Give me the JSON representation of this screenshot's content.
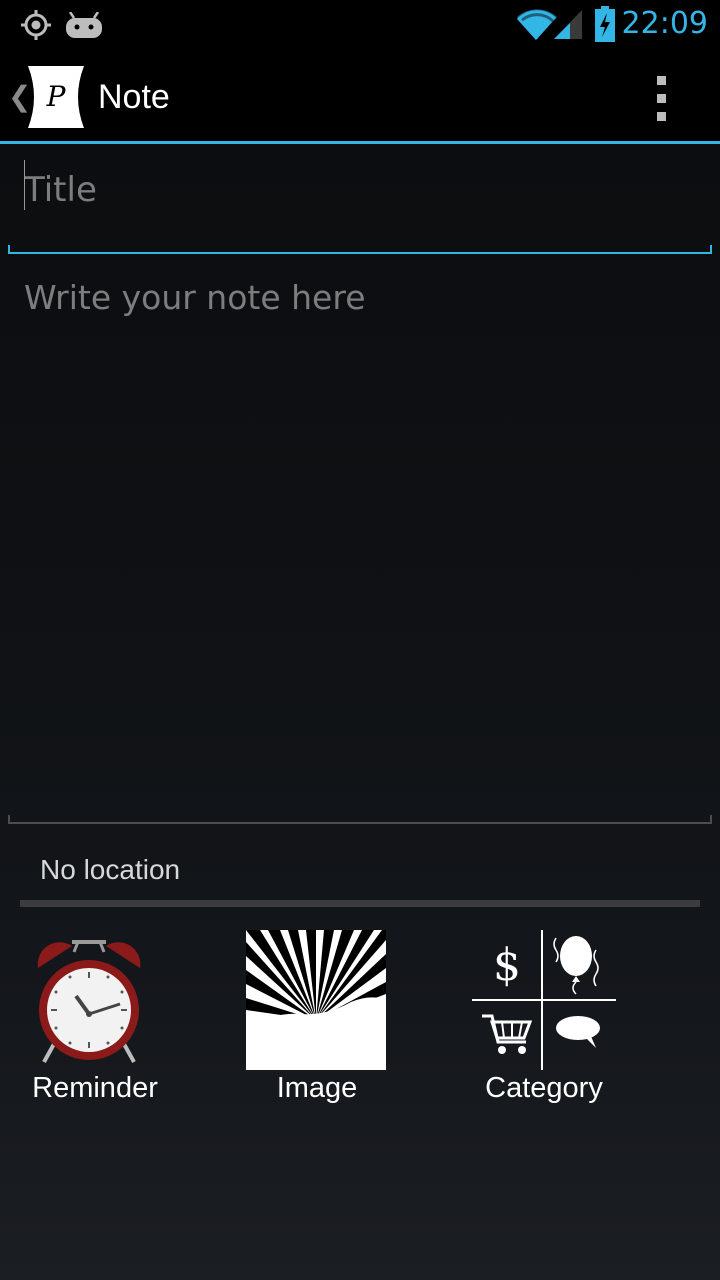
{
  "status_bar": {
    "time": "22:09",
    "icons": [
      "location-icon",
      "android-icon",
      "wifi-icon",
      "signal-icon",
      "battery-charging-icon"
    ]
  },
  "action_bar": {
    "logo_letter": "P",
    "title": "Note",
    "overflow_icon": "overflow-menu-icon"
  },
  "editor": {
    "title_placeholder": "Title",
    "title_value": "",
    "note_placeholder": "Write your note here",
    "note_value": ""
  },
  "location": {
    "text": "No location"
  },
  "actions": [
    {
      "label": "Reminder",
      "icon": "alarm-clock-icon"
    },
    {
      "label": "Image",
      "icon": "image-icon"
    },
    {
      "label": "Category",
      "icon": "category-icon"
    }
  ],
  "colors": {
    "accent": "#33b5e5",
    "background": "#0e1013",
    "hint_text": "#7d7d7d"
  }
}
